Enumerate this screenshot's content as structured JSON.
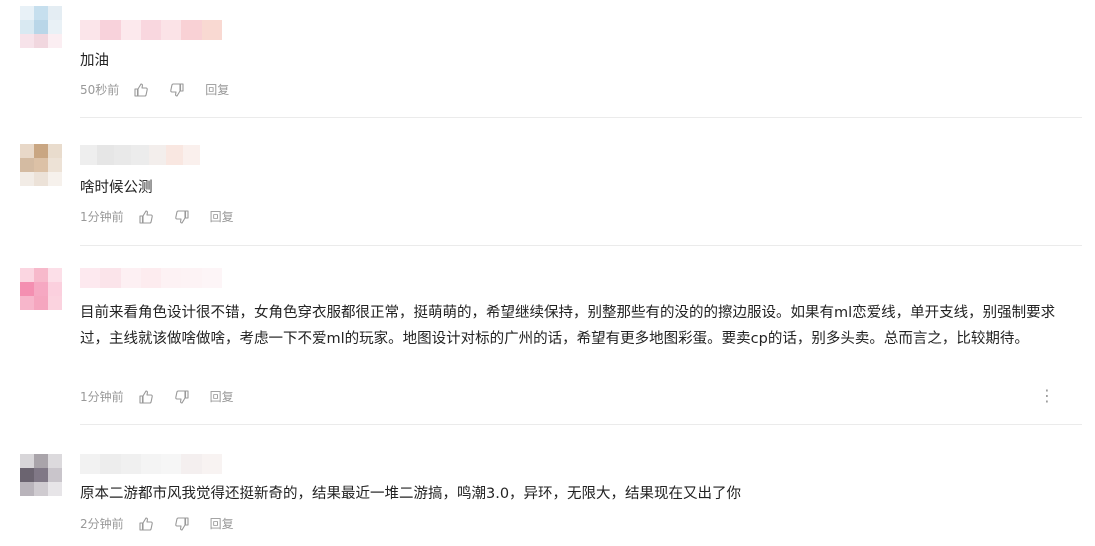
{
  "comments": [
    {
      "text": "加油",
      "time": "50秒前",
      "reply_label": "回复",
      "avatar_colors": [
        "#e8f1f7",
        "#c6dfee",
        "#e4edf3",
        "#d9e9f2",
        "#b9d6e8",
        "#e9f1f6",
        "#f7e3ea",
        "#f1d7df",
        "#fbeef2"
      ],
      "name_colors": [
        "#fbe5ea",
        "#f8d2db",
        "#fce9ed",
        "#f9d7df",
        "#fbe3e7",
        "#f9d1d5",
        "#f9d9d2"
      ]
    },
    {
      "text": "啥时候公测",
      "time": "1分钟前",
      "reply_label": "回复",
      "avatar_colors": [
        "#e8d8c8",
        "#c9a682",
        "#e9dccd",
        "#d4bba2",
        "#dcc1a6",
        "#ede2d6",
        "#f2ece6",
        "#ece2d8",
        "#f6f1ec"
      ],
      "name_colors": [
        "#eeeeee",
        "#e6e6e6",
        "#e9e9e9",
        "#ececec",
        "#f3eeec",
        "#f9e7e1",
        "#faf0ed"
      ]
    },
    {
      "text": "目前来看角色设计很不错，女角色穿衣服都很正常，挺萌萌的，希望继续保持，别整那些有的没的的擦边服设。如果有ml恋爱线，单开支线，别强制要求过，主线就该做啥做啥，考虑一下不爱ml的玩家。地图设计对标的广州的话，希望有更多地图彩蛋。要卖cp的话，别多头卖。总而言之，比较期待。",
      "time": "1分钟前",
      "reply_label": "回复",
      "more_label": "⋮",
      "avatar_colors": [
        "#fbd6e1",
        "#f7b9cb",
        "#fcdfe8",
        "#f48fb1",
        "#f6a8c2",
        "#fbd0de",
        "#f7b6cb",
        "#f5a6bf",
        "#fbd3df"
      ],
      "name_colors": [
        "#fde9ef",
        "#fbe4ea",
        "#fdf0f3",
        "#fdecef",
        "#fdf2f4",
        "#fdf3f5",
        "#fdf5f7"
      ]
    },
    {
      "text": "原本二游都市风我觉得还挺新奇的，结果最近一堆二游搞，鸣潮3.0，异环，无限大，结果现在又出了你",
      "time": "2分钟前",
      "reply_label": "回复",
      "avatar_colors": [
        "#d8d6d9",
        "#a9a4aa",
        "#dcdadd",
        "#6b6470",
        "#807886",
        "#c9c5cb",
        "#b9b4bb",
        "#cfcbd0",
        "#e7e5e8"
      ],
      "name_colors": [
        "#f2f2f2",
        "#ededed",
        "#f0f0f0",
        "#f4f4f4",
        "#f6f6f6",
        "#f4efef",
        "#f8f3f2"
      ]
    }
  ]
}
